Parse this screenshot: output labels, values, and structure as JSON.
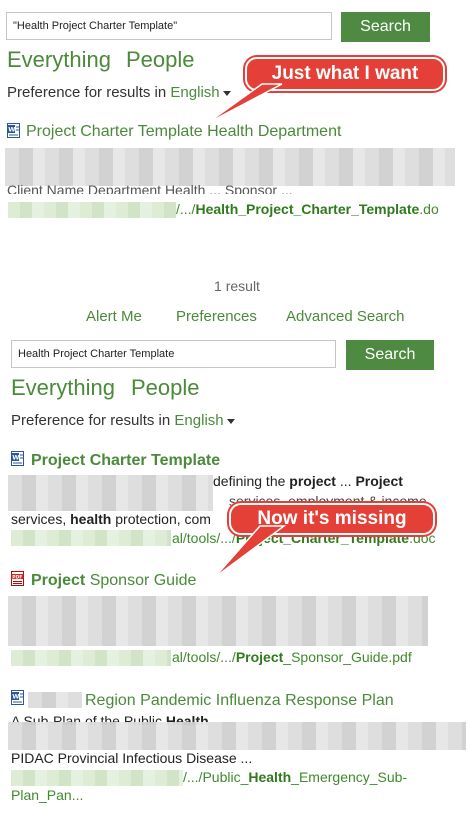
{
  "top": {
    "search_value": "\"Health Project Charter Template\"",
    "search_button": "Search",
    "scopes": [
      "Everything",
      "People"
    ],
    "pref_prefix": "Preference for results in",
    "pref_lang": "English",
    "result1": {
      "title": "Project Charter Template Health Department",
      "snippet": "Client Name Department Health ... Sponsor ...",
      "url_prefix": "/.../",
      "url_bold": "Health_Project_Charter_Template",
      "url_suffix": ".do"
    },
    "callout": "Just what I want"
  },
  "middle": {
    "count": "1 result",
    "links": [
      "Alert Me",
      "Preferences",
      "Advanced Search"
    ]
  },
  "bottom": {
    "search_value": "Health Project Charter Template",
    "search_button": "Search",
    "scopes": [
      "Everything",
      "People"
    ],
    "pref_prefix": "Preference for results in",
    "pref_lang": "English",
    "result1": {
      "title": "Project Charter Template",
      "snip1_text": "defining the ",
      "snip1_b1": "project",
      "snip1_mid": " ... ",
      "snip1_b2": "Project",
      "snip2": "services, employment & income",
      "snip3_pre": "services, ",
      "snip3_b": "health",
      "snip3_post": " protection, com",
      "url_prefix": "al/tools/.../",
      "url_bold": "Project_Charter_Template",
      "url_suffix": ".doc"
    },
    "callout": "Now it's missing",
    "result2": {
      "title_bold": "Project",
      "title_rest": " Sponsor Guide",
      "url_prefix": "al/tools/.../",
      "url_bold": "Project",
      "url_suffix": "_Sponsor_Guide.pdf"
    },
    "result3": {
      "title": "Region Pandemic Influenza Response Plan",
      "snip1": "A Sub-Plan of the Public ",
      "snip1_b": "Health",
      "snip2": "PIDAC Provincial Infectious Disease ...",
      "url_prefix": "/.../Public_",
      "url_bold": "Health",
      "url_suffix": "_Emergency_Sub-",
      "url_line2": "Plan_Pan..."
    }
  },
  "colors": {
    "accent": "#4f8a43",
    "link": "#4a8a3a",
    "callout": "#e44037"
  },
  "icons": [
    "word-doc-icon",
    "pdf-doc-icon"
  ]
}
